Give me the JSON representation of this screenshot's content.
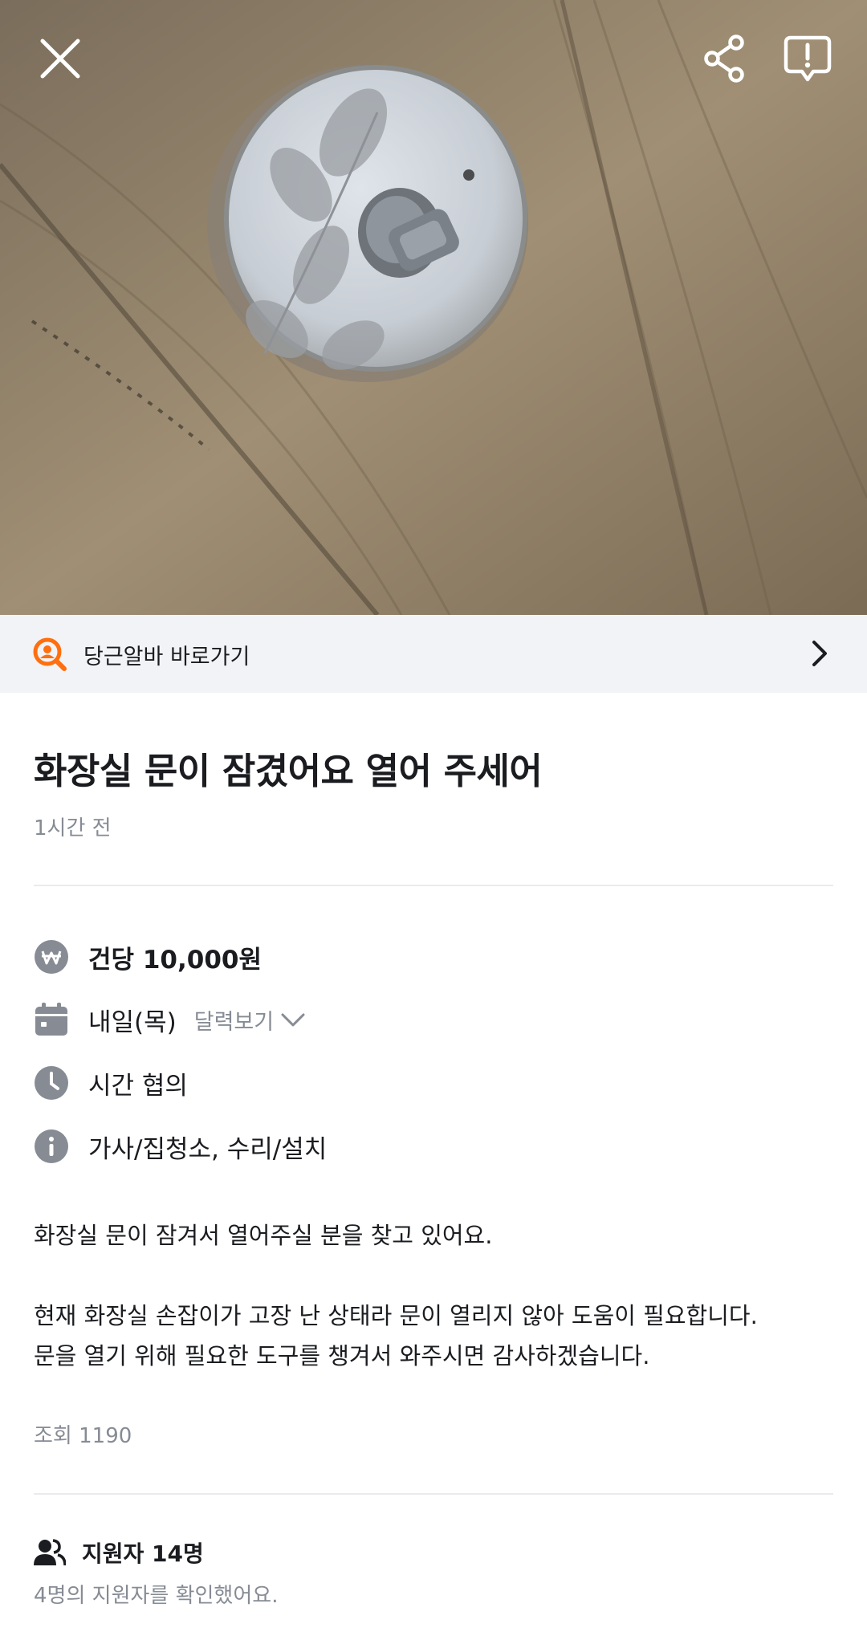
{
  "header": {
    "close_icon": "close-icon",
    "share_icon": "share-icon",
    "report_icon": "report-icon"
  },
  "banner": {
    "label": "당근알바 바로가기",
    "accent": "#ff6f0f"
  },
  "post": {
    "title": "화장실 문이 잠겼어요 열어 주세어",
    "time": "1시간 전",
    "pay": "건당 10,000원",
    "date": "내일(목)",
    "calendar_link": "달력보기",
    "work_time": "시간 협의",
    "category": "가사/집청소, 수리/설치",
    "body_line1": "화장실 문이 잠겨서 열어주실 분을 찾고 있어요.",
    "body_line2": "현재 화장실 손잡이가 고장 난 상태라 문이 열리지 않아 도움이 필요합니다.",
    "body_line3": "문을 열기 위해 필요한 도구를 챙겨서 와주시면 감사하겠습니다.",
    "views": "조회 1190"
  },
  "applicants": {
    "label": "지원자 14명",
    "checked": "4명의 지원자를 확인했어요."
  },
  "colors": {
    "text": "#1a1c20",
    "muted": "#868b94",
    "icon": "#868b94",
    "banner_bg": "#f2f3f6"
  }
}
